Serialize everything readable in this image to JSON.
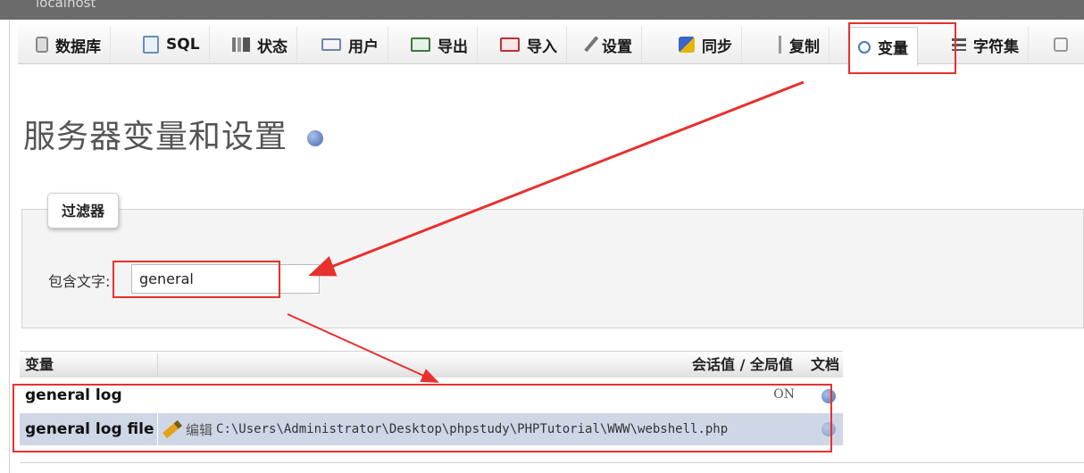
{
  "window": {
    "server": "localhost"
  },
  "tabs": [
    {
      "label": "数据库",
      "icon": "database-icon"
    },
    {
      "label": "SQL",
      "icon": "sql-icon"
    },
    {
      "label": "状态",
      "icon": "status-icon"
    },
    {
      "label": "用户",
      "icon": "users-icon"
    },
    {
      "label": "导出",
      "icon": "export-icon"
    },
    {
      "label": "导入",
      "icon": "import-icon"
    },
    {
      "label": "设置",
      "icon": "settings-icon"
    },
    {
      "label": "同步",
      "icon": "sync-icon"
    },
    {
      "label": "复制",
      "icon": "replication-icon"
    },
    {
      "label": "变量",
      "icon": "variables-icon",
      "active": true
    },
    {
      "label": "字符集",
      "icon": "charset-icon"
    }
  ],
  "page": {
    "title": "服务器变量和设置"
  },
  "filter": {
    "legend": "过滤器",
    "label": "包含文字:",
    "value": "general"
  },
  "table": {
    "headers": {
      "variable": "变量",
      "value": "会话值 / 全局值",
      "doc": "文档"
    },
    "rows": [
      {
        "name": "general log",
        "value": "ON"
      },
      {
        "name": "general log file",
        "edit_label": "编辑",
        "value": "C:\\Users\\Administrator\\Desktop\\phpstudy\\PHPTutorial\\WWW\\webshell.php"
      }
    ]
  },
  "colors": {
    "highlight": "#e8302f",
    "selected_row": "#cfd7e6"
  }
}
